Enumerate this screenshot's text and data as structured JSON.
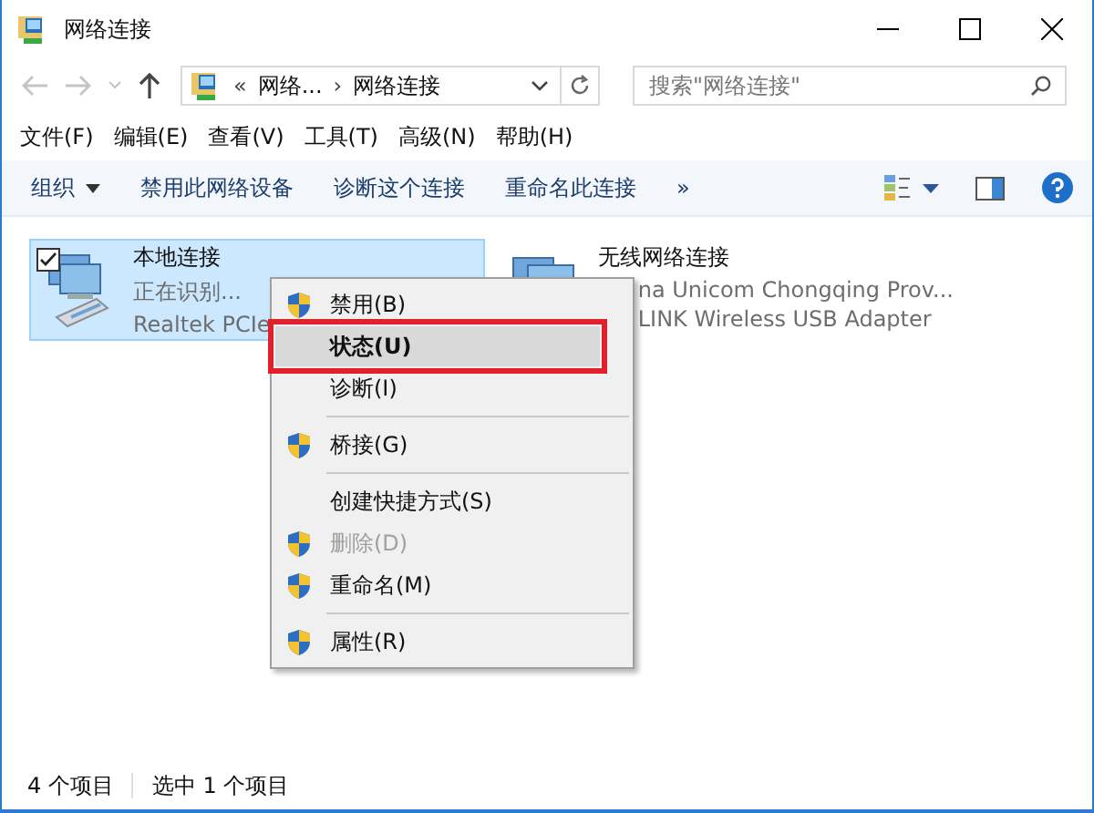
{
  "window": {
    "title": "网络连接"
  },
  "address_bar": {
    "overflow": "«",
    "crumbs": [
      "网络...",
      "网络连接"
    ],
    "separator": "›"
  },
  "search": {
    "placeholder": "搜索\"网络连接\""
  },
  "menu_bar": [
    "文件(F)",
    "编辑(E)",
    "查看(V)",
    "工具(T)",
    "高级(N)",
    "帮助(H)"
  ],
  "toolbar": {
    "items": [
      {
        "label": "组织",
        "dropdown": true
      },
      {
        "label": "禁用此网络设备",
        "dropdown": false
      },
      {
        "label": "诊断这个连接",
        "dropdown": false
      },
      {
        "label": "重命名此连接",
        "dropdown": false
      }
    ],
    "more": "»"
  },
  "connections": [
    {
      "name": "本地连接",
      "status": "正在识别...",
      "device": "Realtek PCIe",
      "kind": "wired",
      "selected": true,
      "checked": true
    },
    {
      "name": "无线网络连接",
      "status": "na Unicom Chongqing Prov...",
      "device": "LINK Wireless USB Adapter",
      "kind": "wireless",
      "selected": false,
      "checked": false
    }
  ],
  "context_menu": [
    {
      "kind": "item",
      "label": "禁用(B)",
      "shield": true,
      "disabled": false,
      "selected": false,
      "bold": false,
      "annotated": false
    },
    {
      "kind": "item",
      "label": "状态(U)",
      "shield": false,
      "disabled": false,
      "selected": true,
      "bold": true,
      "annotated": true
    },
    {
      "kind": "item",
      "label": "诊断(I)",
      "shield": false,
      "disabled": false,
      "selected": false,
      "bold": false,
      "annotated": false
    },
    {
      "kind": "separator"
    },
    {
      "kind": "item",
      "label": "桥接(G)",
      "shield": true,
      "disabled": false,
      "selected": false,
      "bold": false,
      "annotated": false
    },
    {
      "kind": "separator"
    },
    {
      "kind": "item",
      "label": "创建快捷方式(S)",
      "shield": false,
      "disabled": false,
      "selected": false,
      "bold": false,
      "annotated": false
    },
    {
      "kind": "item",
      "label": "删除(D)",
      "shield": true,
      "disabled": true,
      "selected": false,
      "bold": false,
      "annotated": false
    },
    {
      "kind": "item",
      "label": "重命名(M)",
      "shield": true,
      "disabled": false,
      "selected": false,
      "bold": false,
      "annotated": false
    },
    {
      "kind": "separator"
    },
    {
      "kind": "item",
      "label": "属性(R)",
      "shield": true,
      "disabled": false,
      "selected": false,
      "bold": false,
      "annotated": false
    }
  ],
  "status_bar": [
    "4 个项目",
    "选中 1 个项目"
  ]
}
